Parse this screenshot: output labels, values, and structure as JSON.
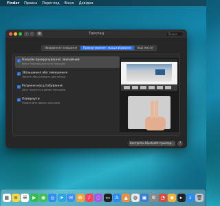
{
  "menubar": {
    "app": "Finder",
    "items": [
      "Правка",
      "Перегляд",
      "Вікно",
      "Довідка"
    ]
  },
  "window": {
    "title": "Трекпад",
    "search_placeholder": "Пошук",
    "tabs": [
      {
        "label": "Наведення і клацання",
        "active": false
      },
      {
        "label": "Прокручування і масштабування",
        "active": true
      },
      {
        "label": "Інші жести",
        "active": false
      }
    ],
    "options": [
      {
        "title": "Напрям прокручування: звичайний",
        "subtitle": "Вміст переміщається за пальцем",
        "checked": true
      },
      {
        "title": "Збільшення або зменшення",
        "subtitle": "Зведіть або розведіть два пальці",
        "checked": true
      },
      {
        "title": "Розумне масштабування",
        "subtitle": "Двічі торкніться двома пальцями",
        "checked": true
      },
      {
        "title": "Повернути",
        "subtitle": "Повертайте двома пальцями",
        "checked": true
      }
    ],
    "bluetooth_button": "Настроїти Bluetooth-трекпад…",
    "help": "?"
  },
  "colors": {
    "accent": "#2d6fe0",
    "window_bg": "#262626"
  },
  "dock": [
    {
      "name": "calendar",
      "glyph": "▦",
      "color": "#ffffff"
    },
    {
      "name": "notes",
      "glyph": "≡",
      "color": "#f5d54a"
    },
    {
      "name": "reminders",
      "glyph": "☰",
      "color": "#ffffff"
    },
    {
      "name": "facetime",
      "glyph": "▶",
      "color": "#2fbf4a"
    },
    {
      "name": "messages",
      "glyph": "◉",
      "color": "#3fc04f"
    },
    {
      "name": "safari",
      "glyph": "◎",
      "color": "#2b8cf0"
    },
    {
      "name": "telegram",
      "glyph": "➤",
      "color": "#2aa3e0"
    },
    {
      "name": "mail",
      "glyph": "✉",
      "color": "#3b8ff0"
    },
    {
      "name": "photos",
      "glyph": "✿",
      "color": "#f0a43b"
    },
    {
      "name": "music",
      "glyph": "♪",
      "color": "#f5465a"
    },
    {
      "name": "podcasts",
      "glyph": "◌",
      "color": "#a45be0"
    },
    {
      "name": "tv",
      "glyph": "▭",
      "color": "#222222"
    },
    {
      "name": "app-store",
      "glyph": "A",
      "color": "#2b8cf0"
    },
    {
      "name": "maps",
      "glyph": "▲",
      "color": "#f08c3b"
    },
    {
      "name": "chrome",
      "glyph": "◍",
      "color": "#e8e8e8"
    },
    {
      "name": "preview",
      "glyph": "▣",
      "color": "#3b7bd8"
    },
    {
      "name": "settings",
      "glyph": "⚙",
      "color": "#8a8a8a"
    },
    {
      "name": "browser",
      "glyph": "◔",
      "color": "#d94a3b"
    },
    {
      "name": "sketch",
      "glyph": "◆",
      "color": "#f5b03b"
    },
    {
      "name": "terminal",
      "glyph": "▸",
      "color": "#222222"
    },
    {
      "name": "downloads",
      "glyph": "↓",
      "color": "#2b8cf0"
    },
    {
      "name": "trash",
      "glyph": "🗑",
      "color": "#bfc7cf"
    }
  ]
}
